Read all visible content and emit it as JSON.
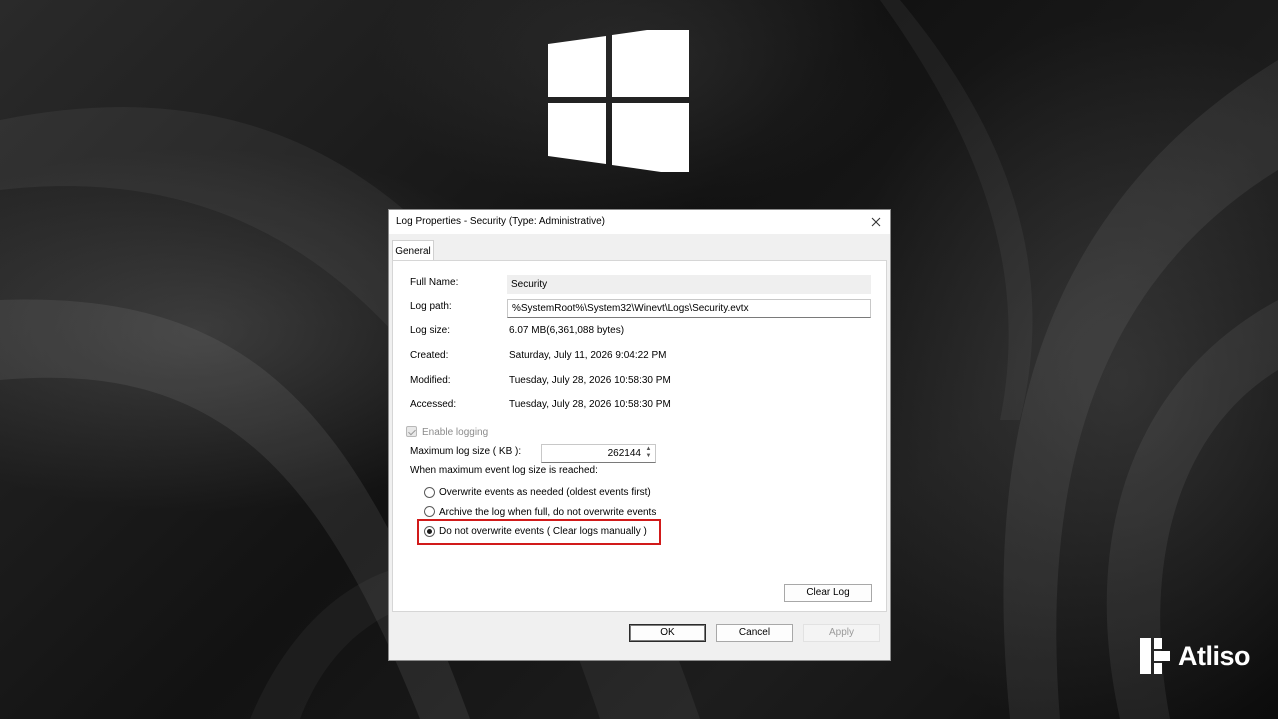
{
  "dialog": {
    "title": "Log Properties - Security (Type: Administrative)",
    "close_glyph": "✕",
    "tabs": [
      {
        "label": "General"
      }
    ]
  },
  "general": {
    "full_name": {
      "label": "Full Name:",
      "value": "Security"
    },
    "log_path": {
      "label": "Log path:",
      "value": "%SystemRoot%\\System32\\Winevt\\Logs\\Security.evtx"
    },
    "log_size": {
      "label": "Log size:",
      "value": "6.07 MB(6,361,088 bytes)"
    },
    "created": {
      "label": "Created:",
      "value": "Saturday, July 11, 2026 9:04:22 PM"
    },
    "modified": {
      "label": "Modified:",
      "value": "Tuesday, July 28, 2026 10:58:30 PM"
    },
    "accessed": {
      "label": "Accessed:",
      "value": "Tuesday, July 28, 2026 10:58:30 PM"
    },
    "enable_logging": {
      "label": "Enable logging",
      "checked": true,
      "disabled": true
    },
    "max_size": {
      "label": "Maximum log size ( KB ):",
      "value": "262144",
      "up": "▲",
      "down": "▼"
    },
    "when_reached_label": "When maximum event log size is reached:",
    "options": [
      {
        "label": "Overwrite events as needed (oldest events first)",
        "selected": false
      },
      {
        "label": "Archive the log when full, do not overwrite events",
        "selected": false
      },
      {
        "label": "Do not overwrite events ( Clear logs manually )",
        "selected": true
      }
    ],
    "clear_log_label": "Clear Log"
  },
  "footer": {
    "ok_label": "OK",
    "cancel_label": "Cancel",
    "apply_label": "Apply"
  },
  "brand": {
    "name": "Atliso"
  },
  "colors": {
    "highlight": "#d11a1a",
    "wallpaper": "#151515"
  },
  "icons": [
    "windows-logo-icon",
    "close-icon",
    "checkbox-check-icon",
    "spin-up-icon",
    "spin-down-icon",
    "atliso-logo-icon"
  ]
}
